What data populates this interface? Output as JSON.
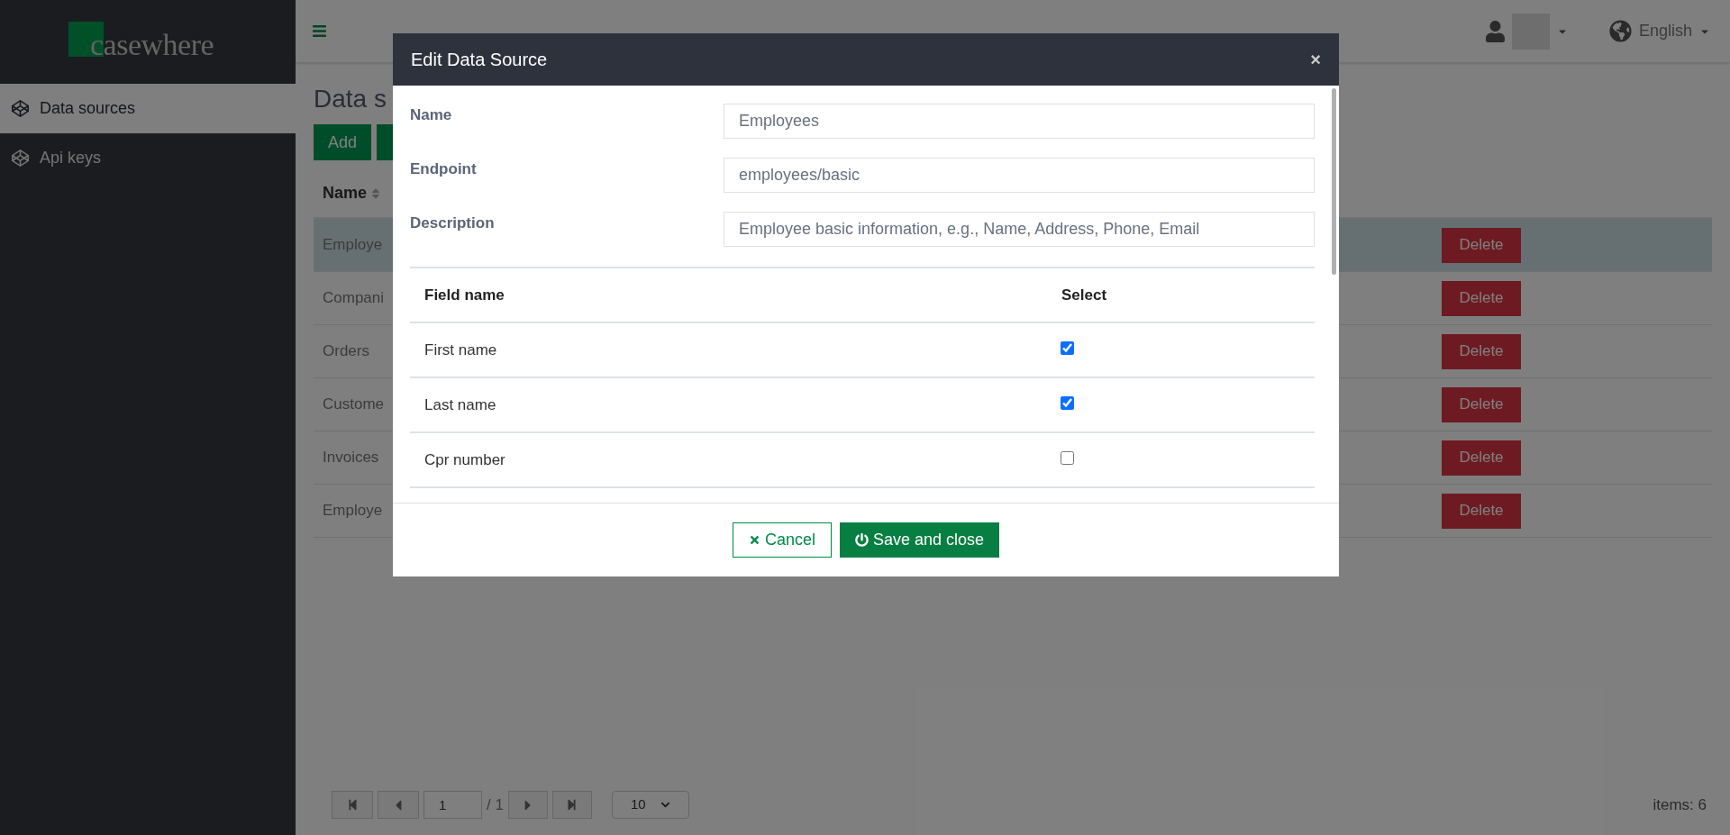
{
  "sidebar": {
    "logo": "casewhere",
    "items": [
      {
        "label": "Data sources",
        "selected": true
      },
      {
        "label": "Api keys",
        "selected": false
      }
    ]
  },
  "header": {
    "language": "English"
  },
  "page": {
    "title": "Data s",
    "add_button": "Add",
    "table": {
      "columns": [
        "Name"
      ],
      "rows": [
        {
          "name": "Employe",
          "delete": "Delete",
          "selected": true
        },
        {
          "name": "Compani",
          "delete": "Delete",
          "selected": false
        },
        {
          "name": "Orders",
          "delete": "Delete",
          "selected": false
        },
        {
          "name": "Custome",
          "delete": "Delete",
          "selected": false
        },
        {
          "name": "Invoices",
          "delete": "Delete",
          "selected": false
        },
        {
          "name": "Employe",
          "delete": "Delete",
          "selected": false
        }
      ]
    },
    "pagination": {
      "page": "1",
      "of": "/ 1",
      "page_size": "10",
      "items": "items: 6"
    }
  },
  "dialog": {
    "title": "Edit Data Source",
    "close": "×",
    "fields": [
      {
        "label": "Name",
        "value": "Employees"
      },
      {
        "label": "Endpoint",
        "value": "employees/basic"
      },
      {
        "label": "Description",
        "value": "Employee basic information, e.g., Name, Address, Phone, Email"
      }
    ],
    "table": {
      "columns": [
        "Field name",
        "Select"
      ],
      "rows": [
        {
          "name": "First name",
          "checked": true
        },
        {
          "name": "Last name",
          "checked": true
        },
        {
          "name": "Cpr number",
          "checked": false
        }
      ]
    },
    "buttons": {
      "cancel": "Cancel",
      "save": "Save and close"
    }
  }
}
